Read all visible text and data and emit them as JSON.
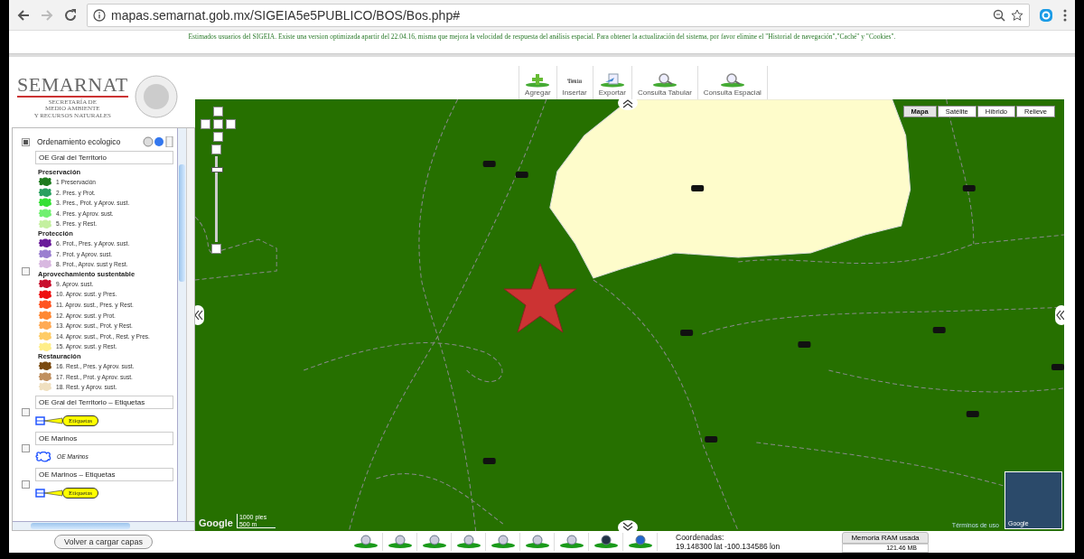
{
  "browser": {
    "url": "mapas.semarnat.gob.mx/SIGEIA5e5PUBLICO/BOS/Bos.php#"
  },
  "notice": "Estimados usuarios del SIGEIA. Existe una version optimizada apartir del 22.04.16, misma que mejora la velocidad de respuesta del análisis espacial.  Para obtener la actualización del sistema, por favor elimine el \"Historial de navegación\",\"Caché\" y \"Cookies\".",
  "logo": {
    "name": "SEMARNAT",
    "subtitle": [
      "SECRETARÍA DE",
      "MEDIO AMBIENTE",
      "Y RECURSOS NATURALES"
    ]
  },
  "toolbar": [
    {
      "label": "Agregar",
      "kind": "add"
    },
    {
      "label": "Insertar",
      "kind": "text",
      "icon_text": "Texto"
    },
    {
      "label": "Exportar",
      "kind": "export"
    },
    {
      "label": "Consulta Tabular",
      "kind": "query"
    },
    {
      "label": "Consulta Espacial",
      "kind": "query"
    }
  ],
  "layer": {
    "name": "Ordenamiento ecologico",
    "checked": true,
    "sublayers": [
      {
        "kind": "legend",
        "title": "OE Gral del Territorio",
        "checked": false,
        "groups": [
          {
            "heading": "Preservación",
            "items": [
              {
                "label": "1 Preservación",
                "color": "#1e7a1e"
              },
              {
                "label": "2.  Pres. y Prot.",
                "color": "#2aa060"
              },
              {
                "label": "3.  Pres., Prot. y Aprov. sust.",
                "color": "#33e033"
              },
              {
                "label": "4.  Pres. y Aprov. sust.",
                "color": "#70f070"
              },
              {
                "label": "5.  Pres. y Rest.",
                "color": "#c4f0a0"
              }
            ]
          },
          {
            "heading": "Protección",
            "items": [
              {
                "label": "6.  Prot., Pres. y Aprov. sust.",
                "color": "#6a1b9a"
              },
              {
                "label": "7.  Prot. y Aprov. sust.",
                "color": "#9b7fd0"
              },
              {
                "label": "8.  Prot., Aprov. sust y Rest.",
                "color": "#d8b8e0"
              }
            ]
          },
          {
            "heading": "Aprovechamiento sustentable",
            "items": [
              {
                "label": "9.   Aprov. sust.",
                "color": "#c8102e"
              },
              {
                "label": "10. Aprov. sust. y Pres.",
                "color": "#ee1111"
              },
              {
                "label": "11. Aprov. sust., Pres. y Rest.",
                "color": "#ff5522"
              },
              {
                "label": "12. Aprov. sust. y Prot.",
                "color": "#ff8833"
              },
              {
                "label": "13. Aprov. sust., Prot. y Rest.",
                "color": "#ffaa55"
              },
              {
                "label": "14. Aprov. sust., Prot., Rest. y Pres.",
                "color": "#ffcc66"
              },
              {
                "label": "15. Aprov. sust. y Rest.",
                "color": "#ffee88"
              }
            ]
          },
          {
            "heading": "Restauración",
            "items": [
              {
                "label": "16. Rest., Pres. y Aprov. sust.",
                "color": "#7a4a10"
              },
              {
                "label": "17. Rest., Prot. y Aprov. sust.",
                "color": "#c09060"
              },
              {
                "label": "18. Rest. y Aprov. sust.",
                "color": "#f0e0c0"
              }
            ]
          }
        ]
      },
      {
        "kind": "labels",
        "title": "OE Gral del Territorio – Etiquetas",
        "checked": false,
        "legend": "Etiquetas"
      },
      {
        "kind": "outline",
        "title": "OE Marinos",
        "checked": false,
        "legend": "OE Marinos"
      },
      {
        "kind": "labels",
        "title": "OE Marinos – Etiquetas",
        "checked": false,
        "legend": "Etiquetas"
      }
    ]
  },
  "reload_button": "Volver a cargar capas",
  "map": {
    "map_types": [
      {
        "label": "Mapa",
        "selected": true
      },
      {
        "label": "Satélite",
        "selected": false
      },
      {
        "label": "Híbrido",
        "selected": false
      },
      {
        "label": "Relieve",
        "selected": false
      }
    ],
    "zoom_slider": {
      "level": 0.87
    },
    "scale": [
      "1000 pies",
      "500 m"
    ],
    "logo": "Google",
    "terms": "Términos de uso",
    "minimap_logo": "Google"
  },
  "coordinates": {
    "label": "Coordenadas:",
    "value": "19.148300 lat   -100.134586 lon"
  },
  "memory": {
    "title": "Memoria RAM usada",
    "value": "121.46 MB"
  }
}
